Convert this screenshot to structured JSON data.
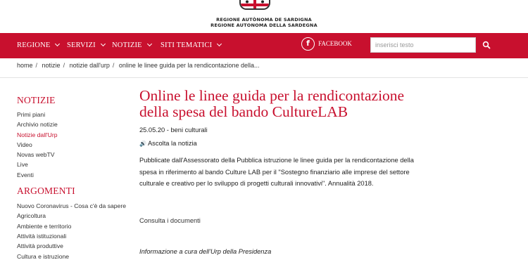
{
  "header": {
    "logo_line1": "REGIONE AUTÒNOMA DE SARDIGNA",
    "logo_line2": "REGIONE AUTONOMA DELLA SARDEGNA"
  },
  "nav": {
    "items": [
      {
        "label": "REGIONE"
      },
      {
        "label": "SERVIZI"
      },
      {
        "label": "NOTIZIE"
      },
      {
        "label": "SITI TEMATICI"
      }
    ],
    "facebook_label": "FACEBOOK",
    "search_placeholder": "inserisci testo"
  },
  "breadcrumb": [
    "home",
    "notizie",
    "notizie dall'urp",
    "online le linee guida per la rendicontazione della..."
  ],
  "sidebar": {
    "notizie_heading": "NOTIZIE",
    "notizie_items": [
      {
        "label": "Primi piani",
        "active": false
      },
      {
        "label": "Archivio notizie",
        "active": false
      },
      {
        "label": "Notizie dall'Urp",
        "active": true
      },
      {
        "label": "Video",
        "active": false
      },
      {
        "label": "Novas webTV",
        "active": false
      },
      {
        "label": "Live",
        "active": false
      },
      {
        "label": "Eventi",
        "active": false
      }
    ],
    "argomenti_heading": "ARGOMENTI",
    "argomenti_items": [
      {
        "label": "Nuovo Coronavirus - Cosa c'è da sapere"
      },
      {
        "label": "Agricoltura"
      },
      {
        "label": "Ambiente e territorio"
      },
      {
        "label": "Attività istituzionali"
      },
      {
        "label": "Attività produttive"
      },
      {
        "label": "Cultura e istruzione"
      }
    ]
  },
  "article": {
    "title": "Online le linee guida per la rendicontazione della spesa del bando CultureLAB",
    "meta": "25.05.20 - beni culturali",
    "listen_label": "Ascolta la notizia",
    "body": "Pubblicate dall'Assessorato della Pubblica istruzione le linee guida per la rendicontazione della spesa in riferimento al bando Culture LAB per il \"Sostegno finanziario alle imprese del settore culturale e creativo per lo sviluppo di progetti culturali innovativi\". Annualità 2018.",
    "documents_link": "Consulta i documenti",
    "info": "Informazione a cura dell'Urp della Presidenza"
  },
  "colors": {
    "brand_red": "#c8102e"
  }
}
